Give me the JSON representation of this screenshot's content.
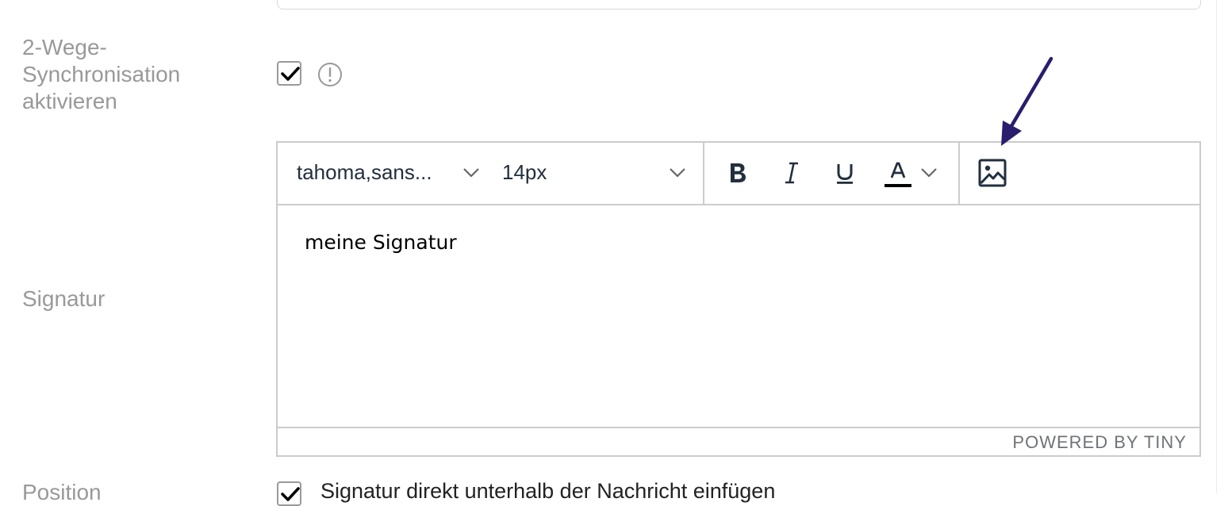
{
  "form": {
    "two_way_sync": {
      "label_lines": [
        "2-Wege-",
        "Synchronisation",
        "aktivieren"
      ],
      "checked": true,
      "info_icon": "info-circle-icon"
    },
    "signature": {
      "label": "Signatur"
    },
    "position": {
      "label": "Position",
      "checkbox_text": "Signatur direkt unterhalb der Nachricht einfügen",
      "checked": true
    }
  },
  "editor": {
    "toolbar": {
      "font_family": "tahoma,sans...",
      "font_size": "14px",
      "buttons": [
        "bold-icon",
        "italic-icon",
        "underline-icon",
        "text-color-icon",
        "chevron-down-icon",
        "image-icon"
      ]
    },
    "content": "meine Signatur",
    "statusbar_brand": "POWERED BY TINY"
  },
  "annotation": {
    "icon": "arrow-icon",
    "color": "#2a1d6e"
  },
  "colors": {
    "label_gray": "#999999",
    "toolbar_icon": "#222f3e",
    "border": "#cccccc"
  }
}
